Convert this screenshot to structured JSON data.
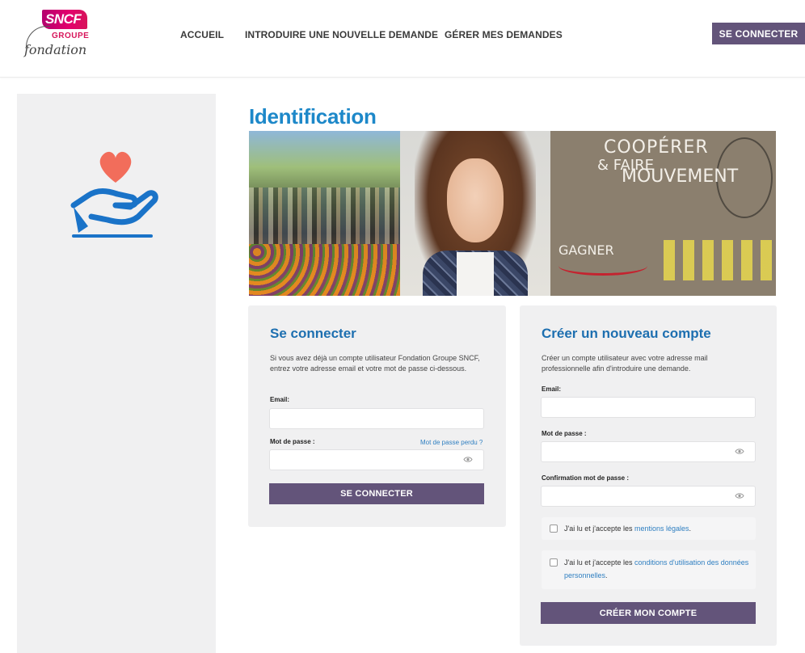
{
  "header": {
    "logo": {
      "badge_text": "SNCF",
      "groupe_text": "GROUPE",
      "fondation_text": "fondation"
    },
    "nav": [
      {
        "label": "ACCUEIL"
      },
      {
        "label": "INTRODUIRE UNE NOUVELLE DEMANDE"
      },
      {
        "label": "GÉRER MES DEMANDES"
      }
    ],
    "login_button": "SE CONNECTER"
  },
  "sidebar": {
    "icon": "heart-in-hand-icon"
  },
  "main": {
    "title": "Identification",
    "hero_image_texts": {
      "line1": "COOPÉRER",
      "line2": "& FAIRE",
      "line3": "MOUVEMENT",
      "line4": "GAGNER"
    }
  },
  "login": {
    "title": "Se connecter",
    "description": "Si vous avez déjà un compte utilisateur Fondation Groupe SNCF, entrez votre adresse email et votre mot de passe ci-dessous.",
    "email_label": "Email:",
    "email_value": "",
    "password_label": "Mot de passe :",
    "password_value": "",
    "forgot_link": "Mot de passe perdu ?",
    "submit": "SE CONNECTER"
  },
  "create": {
    "title": "Créer un nouveau compte",
    "description": "Créer un compte utilisateur avec votre adresse mail professionnelle afin d'introduire une demande.",
    "email_label": "Email:",
    "email_value": "",
    "password_label": "Mot de passe :",
    "password_value": "",
    "confirm_label": "Confirmation mot de passe :",
    "confirm_value": "",
    "legal_prefix": "J'ai lu et j'accepte les ",
    "legal_link": "mentions légales",
    "legal_suffix": ".",
    "data_prefix": "J'ai lu et j'accepte les ",
    "data_link": "conditions d'utilisation des données personnelles",
    "data_suffix": ".",
    "submit": "CRÉER MON COMPTE"
  },
  "colors": {
    "accent": "#63547a",
    "title_blue": "#1d88c9",
    "heart": "#f26d5b",
    "hand": "#1a73c8"
  }
}
